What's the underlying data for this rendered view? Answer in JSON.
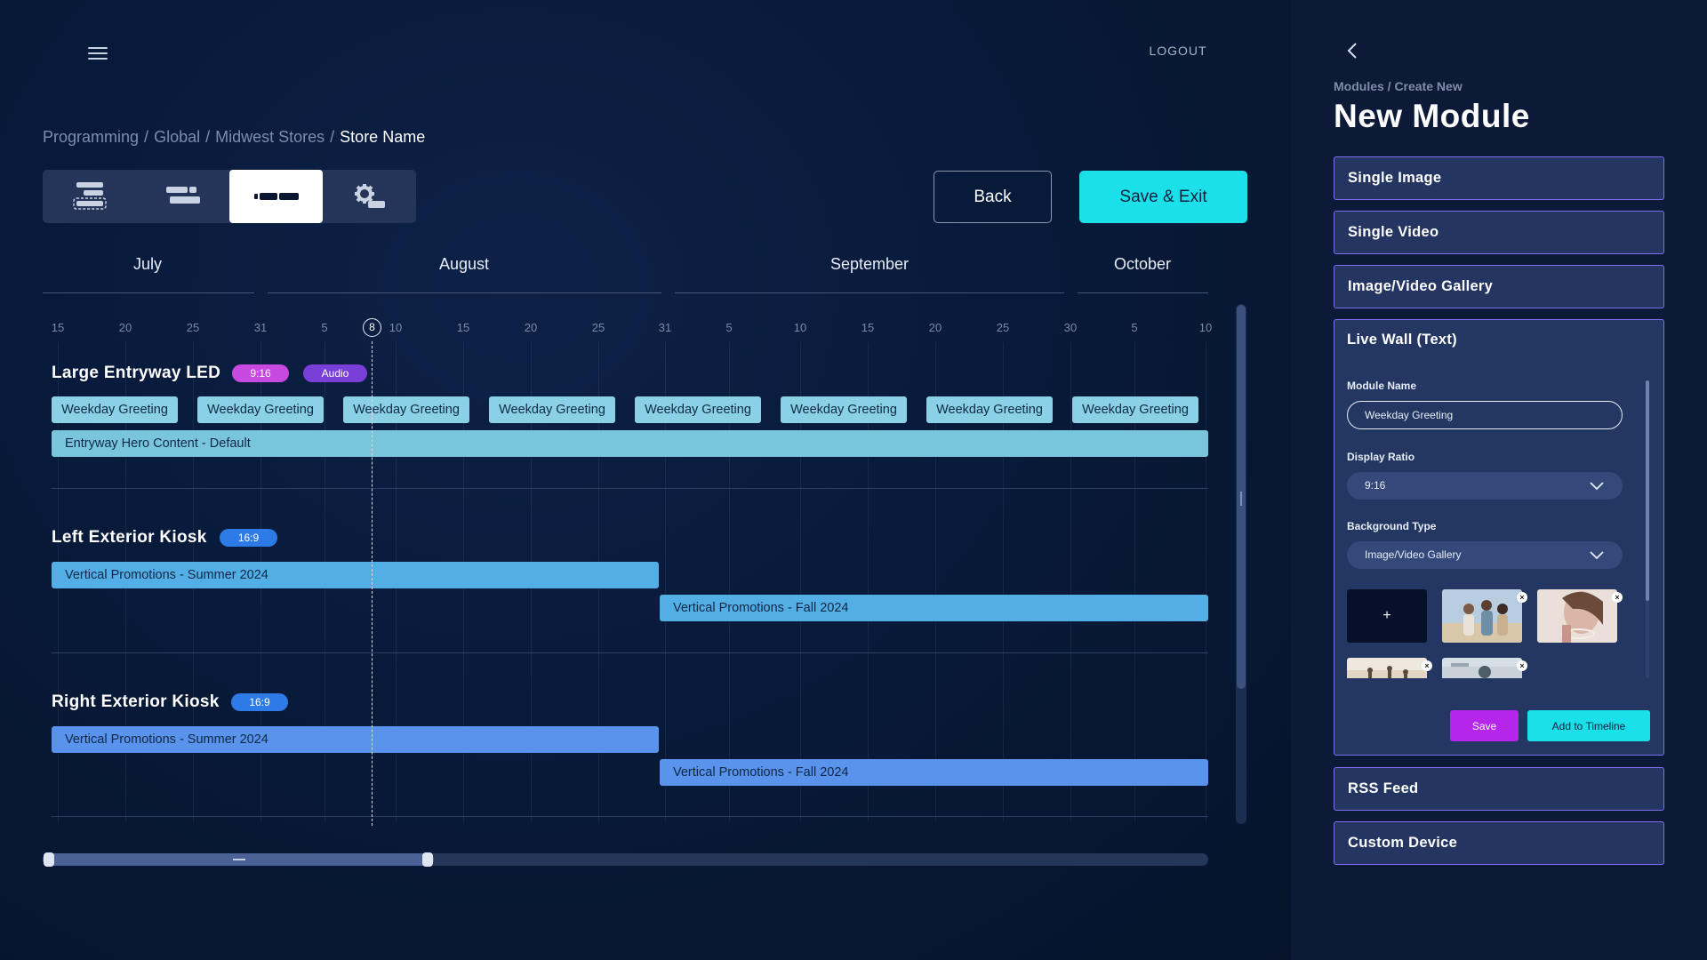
{
  "header": {
    "logout_label": "LOGOUT",
    "menu_icon": "hamburger-menu-icon"
  },
  "breadcrumb": {
    "items": [
      "Programming",
      "Global",
      "Midwest Stores"
    ],
    "current": "Store Name",
    "separator": "/"
  },
  "view_switcher": {
    "options": [
      "timeline-expanded-view",
      "timeline-compact-view",
      "timeline-linear-view",
      "settings-view"
    ],
    "active_index": 2
  },
  "actions": {
    "back_label": "Back",
    "save_exit_label": "Save & Exit"
  },
  "timeline": {
    "months": [
      "July",
      "August",
      "September",
      "October"
    ],
    "days": [
      "15",
      "20",
      "25",
      "31",
      "5",
      "8",
      "10",
      "15",
      "20",
      "25",
      "31",
      "5",
      "10",
      "15",
      "20",
      "25",
      "30",
      "5",
      "10"
    ],
    "today": "8",
    "rows": [
      {
        "title": "Large Entryway LED",
        "tags": [
          "9:16",
          "Audio"
        ],
        "chips": [
          "Weekday Greeting",
          "Weekday Greeting",
          "Weekday Greeting",
          "Weekday Greeting",
          "Weekday Greeting",
          "Weekday Greeting",
          "Weekday Greeting",
          "Weekday Greeting"
        ],
        "bars": [
          "Entryway Hero Content - Default"
        ]
      },
      {
        "title": "Left Exterior Kiosk",
        "tags": [
          "16:9"
        ],
        "bars": [
          "Vertical Promotions - Summer 2024",
          "Vertical Promotions - Fall 2024"
        ]
      },
      {
        "title": "Right Exterior Kiosk",
        "tags": [
          "16:9"
        ],
        "bars": [
          "Vertical Promotions - Summer 2024",
          "Vertical Promotions - Fall 2024"
        ]
      }
    ]
  },
  "panel": {
    "breadcrumb": "Modules / Create New",
    "title": "New Module",
    "items": [
      "Single Image",
      "Single Video",
      "Image/Video Gallery",
      "Live Wall (Text)",
      "RSS Feed",
      "Custom Device"
    ],
    "expanded": {
      "title": "Live Wall (Text)",
      "module_name_label": "Module Name",
      "module_name_value": "Weekday Greeting",
      "display_ratio_label": "Display Ratio",
      "display_ratio_value": "9:16",
      "background_type_label": "Background Type",
      "background_type_value": "Image/Video Gallery",
      "add_media_label": "+",
      "save_label": "Save",
      "add_to_timeline_label": "Add to Timeline"
    }
  },
  "colors": {
    "accent_cyan": "#1be0ea",
    "accent_purple": "#b625ea",
    "tag_pink": "#c849e0",
    "tag_violet": "#7a3fd6",
    "tag_blue": "#2e7ae6",
    "panel_border": "#7b6ff0"
  }
}
